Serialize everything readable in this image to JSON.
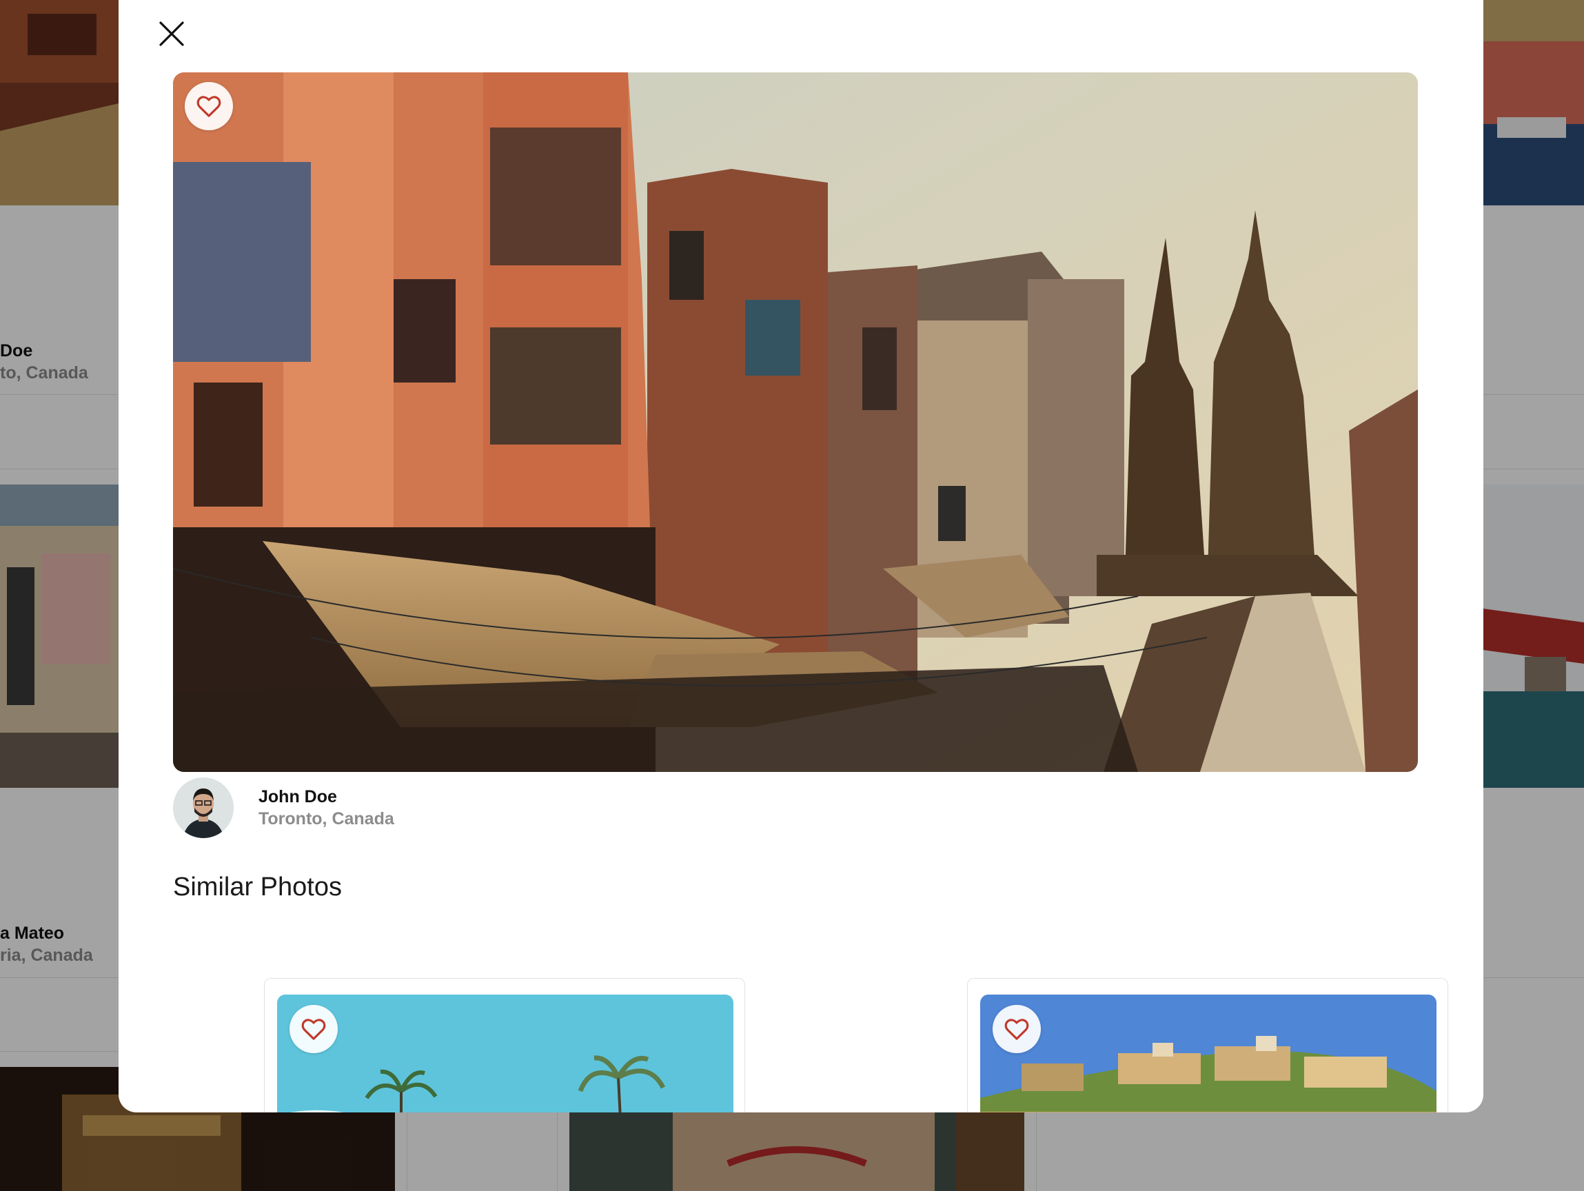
{
  "modal": {
    "close_icon": "close-icon",
    "hero": {
      "like_icon": "heart-icon"
    },
    "author": {
      "name": "John Doe",
      "location": "Toronto, Canada"
    },
    "similar_title": "Similar Photos",
    "similar_cards": [
      {
        "like_icon": "heart-icon"
      },
      {
        "like_icon": "heart-icon"
      }
    ]
  },
  "background": {
    "users": [
      {
        "name": "Doe",
        "location": "to, Canada"
      },
      {
        "name": "a Mateo",
        "location": "ria, Canada"
      }
    ]
  },
  "colors": {
    "heart": "#c0392b",
    "overlay": "#000000"
  }
}
